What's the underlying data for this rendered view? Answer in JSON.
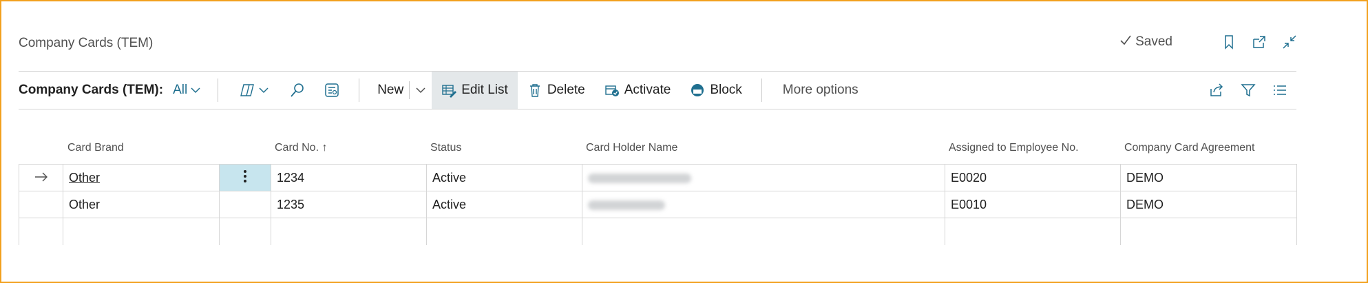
{
  "page": {
    "title": "Company Cards (TEM)",
    "saved_label": "Saved"
  },
  "actionbar": {
    "caption": "Company Cards (TEM):",
    "filter_label": "All",
    "new_label": "New",
    "edit_list_label": "Edit List",
    "delete_label": "Delete",
    "activate_label": "Activate",
    "block_label": "Block",
    "more_options_label": "More options"
  },
  "table": {
    "columns": [
      "Card Brand",
      "Card No. ↑",
      "Status",
      "Card Holder Name",
      "Assigned to Employee No.",
      "Company Card Agreement"
    ],
    "rows": [
      {
        "card_brand": "Other",
        "card_no": "1234",
        "status": "Active",
        "card_holder": "",
        "employee_no": "E0020",
        "agreement": "DEMO",
        "selected": true
      },
      {
        "card_brand": "Other",
        "card_no": "1235",
        "status": "Active",
        "card_holder": "",
        "employee_no": "E0010",
        "agreement": "DEMO",
        "selected": false
      }
    ]
  },
  "colors": {
    "accent": "#1f6f8f",
    "selected_cell": "#c7e5ee",
    "frame": "#f2a11e"
  },
  "icons": {
    "saved": "check-icon",
    "bookmark": "bookmark-icon",
    "open_new": "open-in-new-window-icon",
    "collapse": "collapse-icon",
    "copilot": "copilot-icon",
    "search": "search-icon",
    "analysis": "data-analysis-icon",
    "share": "share-icon",
    "filter": "filter-icon",
    "list": "list-view-icon"
  }
}
